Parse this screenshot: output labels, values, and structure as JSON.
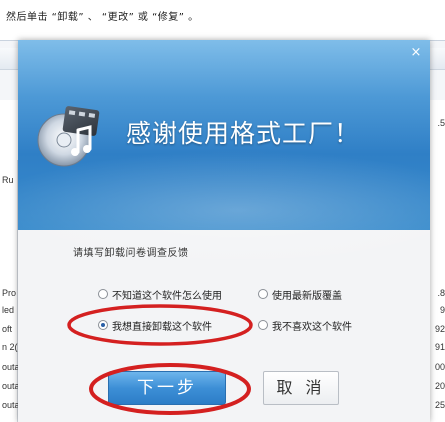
{
  "caption": "然后单击 “卸载” 、 “更改” 或 “修复” 。",
  "background": {
    "left_rows": [
      "Ru",
      "Pro",
      "led",
      "oft",
      "n 2(",
      "outa",
      "outa",
      "outa"
    ],
    "right_rows": [
      ".5",
      ".8",
      "9",
      "92",
      "91",
      "00",
      "20",
      "25"
    ]
  },
  "dialog": {
    "close_label": "×",
    "title": "感谢使用格式工厂！",
    "survey_label": "请填写卸载问卷调查反馈",
    "options": [
      {
        "label": "不知道这个软件怎么使用",
        "checked": false
      },
      {
        "label": "使用最新版覆盖",
        "checked": false
      },
      {
        "label": "我想直接卸载这个软件",
        "checked": true
      },
      {
        "label": "我不喜欢这个软件",
        "checked": false
      }
    ],
    "next_label": "下一步",
    "cancel_label": "取 消"
  },
  "colors": {
    "banner": "#3a8ccc",
    "annotation": "#d42020",
    "next_button": "#3d8fd6"
  }
}
